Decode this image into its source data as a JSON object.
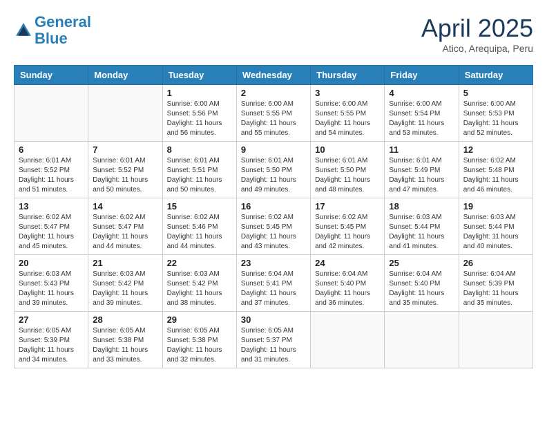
{
  "logo": {
    "line1": "General",
    "line2": "Blue"
  },
  "title": "April 2025",
  "subtitle": "Atico, Arequipa, Peru",
  "weekdays": [
    "Sunday",
    "Monday",
    "Tuesday",
    "Wednesday",
    "Thursday",
    "Friday",
    "Saturday"
  ],
  "weeks": [
    [
      {
        "day": "",
        "info": ""
      },
      {
        "day": "",
        "info": ""
      },
      {
        "day": "1",
        "info": "Sunrise: 6:00 AM\nSunset: 5:56 PM\nDaylight: 11 hours\nand 56 minutes."
      },
      {
        "day": "2",
        "info": "Sunrise: 6:00 AM\nSunset: 5:55 PM\nDaylight: 11 hours\nand 55 minutes."
      },
      {
        "day": "3",
        "info": "Sunrise: 6:00 AM\nSunset: 5:55 PM\nDaylight: 11 hours\nand 54 minutes."
      },
      {
        "day": "4",
        "info": "Sunrise: 6:00 AM\nSunset: 5:54 PM\nDaylight: 11 hours\nand 53 minutes."
      },
      {
        "day": "5",
        "info": "Sunrise: 6:00 AM\nSunset: 5:53 PM\nDaylight: 11 hours\nand 52 minutes."
      }
    ],
    [
      {
        "day": "6",
        "info": "Sunrise: 6:01 AM\nSunset: 5:52 PM\nDaylight: 11 hours\nand 51 minutes."
      },
      {
        "day": "7",
        "info": "Sunrise: 6:01 AM\nSunset: 5:52 PM\nDaylight: 11 hours\nand 50 minutes."
      },
      {
        "day": "8",
        "info": "Sunrise: 6:01 AM\nSunset: 5:51 PM\nDaylight: 11 hours\nand 50 minutes."
      },
      {
        "day": "9",
        "info": "Sunrise: 6:01 AM\nSunset: 5:50 PM\nDaylight: 11 hours\nand 49 minutes."
      },
      {
        "day": "10",
        "info": "Sunrise: 6:01 AM\nSunset: 5:50 PM\nDaylight: 11 hours\nand 48 minutes."
      },
      {
        "day": "11",
        "info": "Sunrise: 6:01 AM\nSunset: 5:49 PM\nDaylight: 11 hours\nand 47 minutes."
      },
      {
        "day": "12",
        "info": "Sunrise: 6:02 AM\nSunset: 5:48 PM\nDaylight: 11 hours\nand 46 minutes."
      }
    ],
    [
      {
        "day": "13",
        "info": "Sunrise: 6:02 AM\nSunset: 5:47 PM\nDaylight: 11 hours\nand 45 minutes."
      },
      {
        "day": "14",
        "info": "Sunrise: 6:02 AM\nSunset: 5:47 PM\nDaylight: 11 hours\nand 44 minutes."
      },
      {
        "day": "15",
        "info": "Sunrise: 6:02 AM\nSunset: 5:46 PM\nDaylight: 11 hours\nand 44 minutes."
      },
      {
        "day": "16",
        "info": "Sunrise: 6:02 AM\nSunset: 5:45 PM\nDaylight: 11 hours\nand 43 minutes."
      },
      {
        "day": "17",
        "info": "Sunrise: 6:02 AM\nSunset: 5:45 PM\nDaylight: 11 hours\nand 42 minutes."
      },
      {
        "day": "18",
        "info": "Sunrise: 6:03 AM\nSunset: 5:44 PM\nDaylight: 11 hours\nand 41 minutes."
      },
      {
        "day": "19",
        "info": "Sunrise: 6:03 AM\nSunset: 5:44 PM\nDaylight: 11 hours\nand 40 minutes."
      }
    ],
    [
      {
        "day": "20",
        "info": "Sunrise: 6:03 AM\nSunset: 5:43 PM\nDaylight: 11 hours\nand 39 minutes."
      },
      {
        "day": "21",
        "info": "Sunrise: 6:03 AM\nSunset: 5:42 PM\nDaylight: 11 hours\nand 39 minutes."
      },
      {
        "day": "22",
        "info": "Sunrise: 6:03 AM\nSunset: 5:42 PM\nDaylight: 11 hours\nand 38 minutes."
      },
      {
        "day": "23",
        "info": "Sunrise: 6:04 AM\nSunset: 5:41 PM\nDaylight: 11 hours\nand 37 minutes."
      },
      {
        "day": "24",
        "info": "Sunrise: 6:04 AM\nSunset: 5:40 PM\nDaylight: 11 hours\nand 36 minutes."
      },
      {
        "day": "25",
        "info": "Sunrise: 6:04 AM\nSunset: 5:40 PM\nDaylight: 11 hours\nand 35 minutes."
      },
      {
        "day": "26",
        "info": "Sunrise: 6:04 AM\nSunset: 5:39 PM\nDaylight: 11 hours\nand 35 minutes."
      }
    ],
    [
      {
        "day": "27",
        "info": "Sunrise: 6:05 AM\nSunset: 5:39 PM\nDaylight: 11 hours\nand 34 minutes."
      },
      {
        "day": "28",
        "info": "Sunrise: 6:05 AM\nSunset: 5:38 PM\nDaylight: 11 hours\nand 33 minutes."
      },
      {
        "day": "29",
        "info": "Sunrise: 6:05 AM\nSunset: 5:38 PM\nDaylight: 11 hours\nand 32 minutes."
      },
      {
        "day": "30",
        "info": "Sunrise: 6:05 AM\nSunset: 5:37 PM\nDaylight: 11 hours\nand 31 minutes."
      },
      {
        "day": "",
        "info": ""
      },
      {
        "day": "",
        "info": ""
      },
      {
        "day": "",
        "info": ""
      }
    ]
  ]
}
